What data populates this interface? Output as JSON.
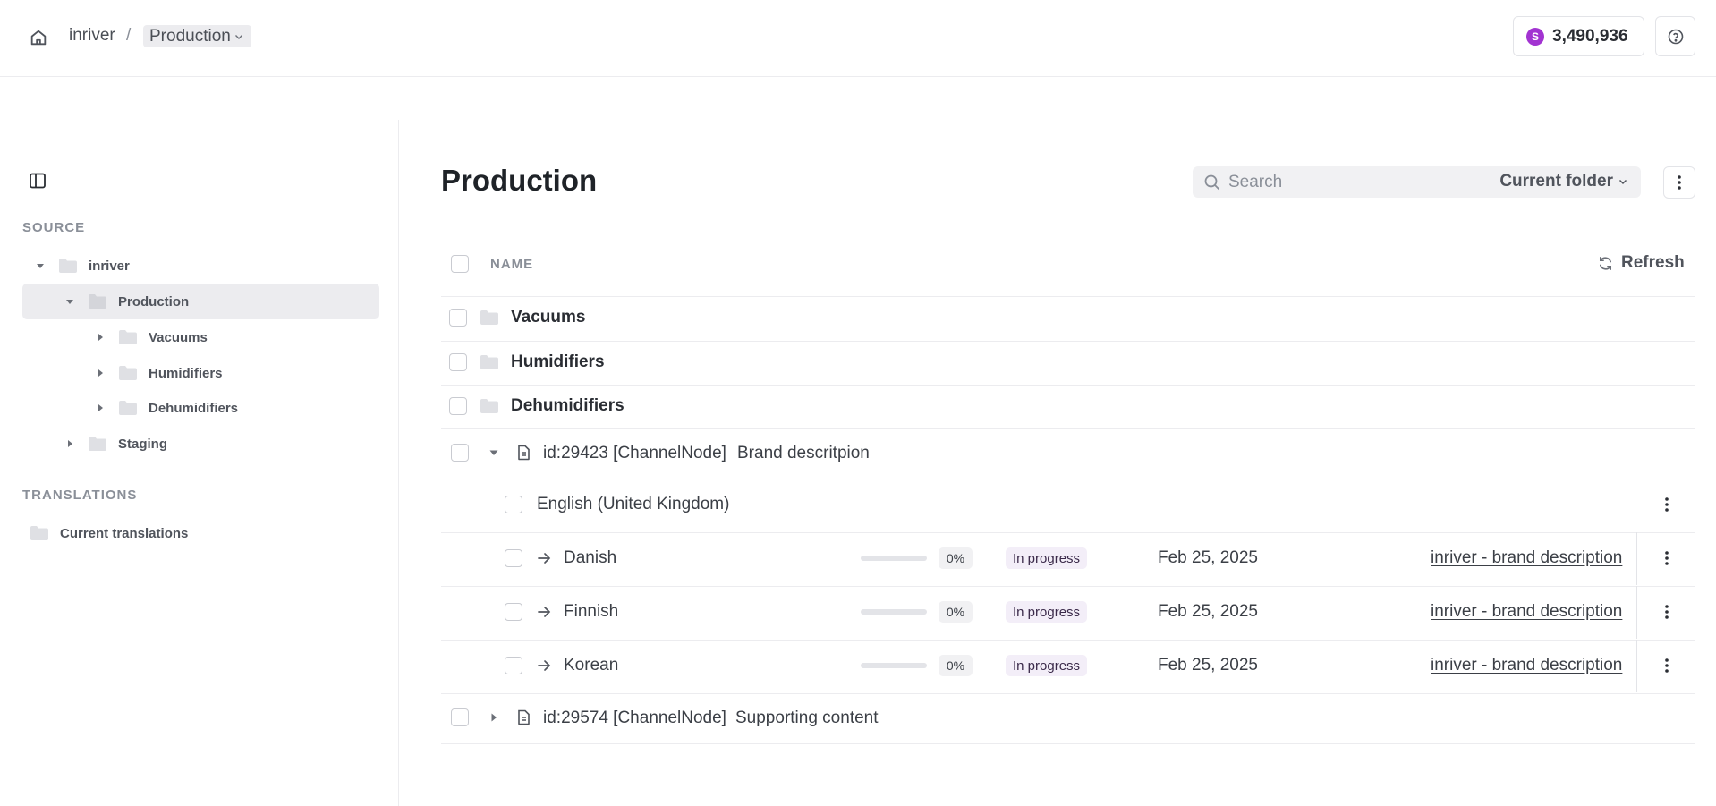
{
  "topbar": {
    "breadcrumb_root": "inriver",
    "breadcrumb_separator": "/",
    "breadcrumb_current": "Production",
    "credits_symbol": "S",
    "credits_value": "3,490,936"
  },
  "sidebar": {
    "source_label": "SOURCE",
    "tree": [
      {
        "label": "inriver",
        "level": 0,
        "expanded": true
      },
      {
        "label": "Production",
        "level": 1,
        "expanded": true,
        "selected": true
      },
      {
        "label": "Vacuums",
        "level": 2,
        "expanded": false
      },
      {
        "label": "Humidifiers",
        "level": 2,
        "expanded": false
      },
      {
        "label": "Dehumidifiers",
        "level": 2,
        "expanded": false
      },
      {
        "label": "Staging",
        "level": 1,
        "expanded": false
      }
    ],
    "translations_label": "TRANSLATIONS",
    "current_translations": "Current translations"
  },
  "main": {
    "title": "Production",
    "search_placeholder": "Search",
    "search_scope": "Current folder",
    "column_name": "NAME",
    "refresh_label": "Refresh",
    "folders": [
      "Vacuums",
      "Humidifiers",
      "Dehumidifiers"
    ],
    "channel_nodes": [
      {
        "id_text": "id:29423 [ChannelNode]",
        "description": "Brand descritpion",
        "expanded": true,
        "source_language": "English (United Kingdom)",
        "translations": [
          {
            "language": "Danish",
            "progress": 0,
            "progress_label": "0%",
            "status": "In progress",
            "date": "Feb 25, 2025",
            "link": "inriver - brand description"
          },
          {
            "language": "Finnish",
            "progress": 0,
            "progress_label": "0%",
            "status": "In progress",
            "date": "Feb 25, 2025",
            "link": "inriver - brand description"
          },
          {
            "language": "Korean",
            "progress": 0,
            "progress_label": "0%",
            "status": "In progress",
            "date": "Feb 25, 2025",
            "link": "inriver - brand description"
          }
        ]
      },
      {
        "id_text": "id:29574 [ChannelNode]",
        "description": "Supporting content",
        "expanded": false
      }
    ]
  },
  "colors": {
    "accent": "#a233d1",
    "selected_row_bg": "#ececef",
    "status_badge_bg": "#f3eef8"
  }
}
